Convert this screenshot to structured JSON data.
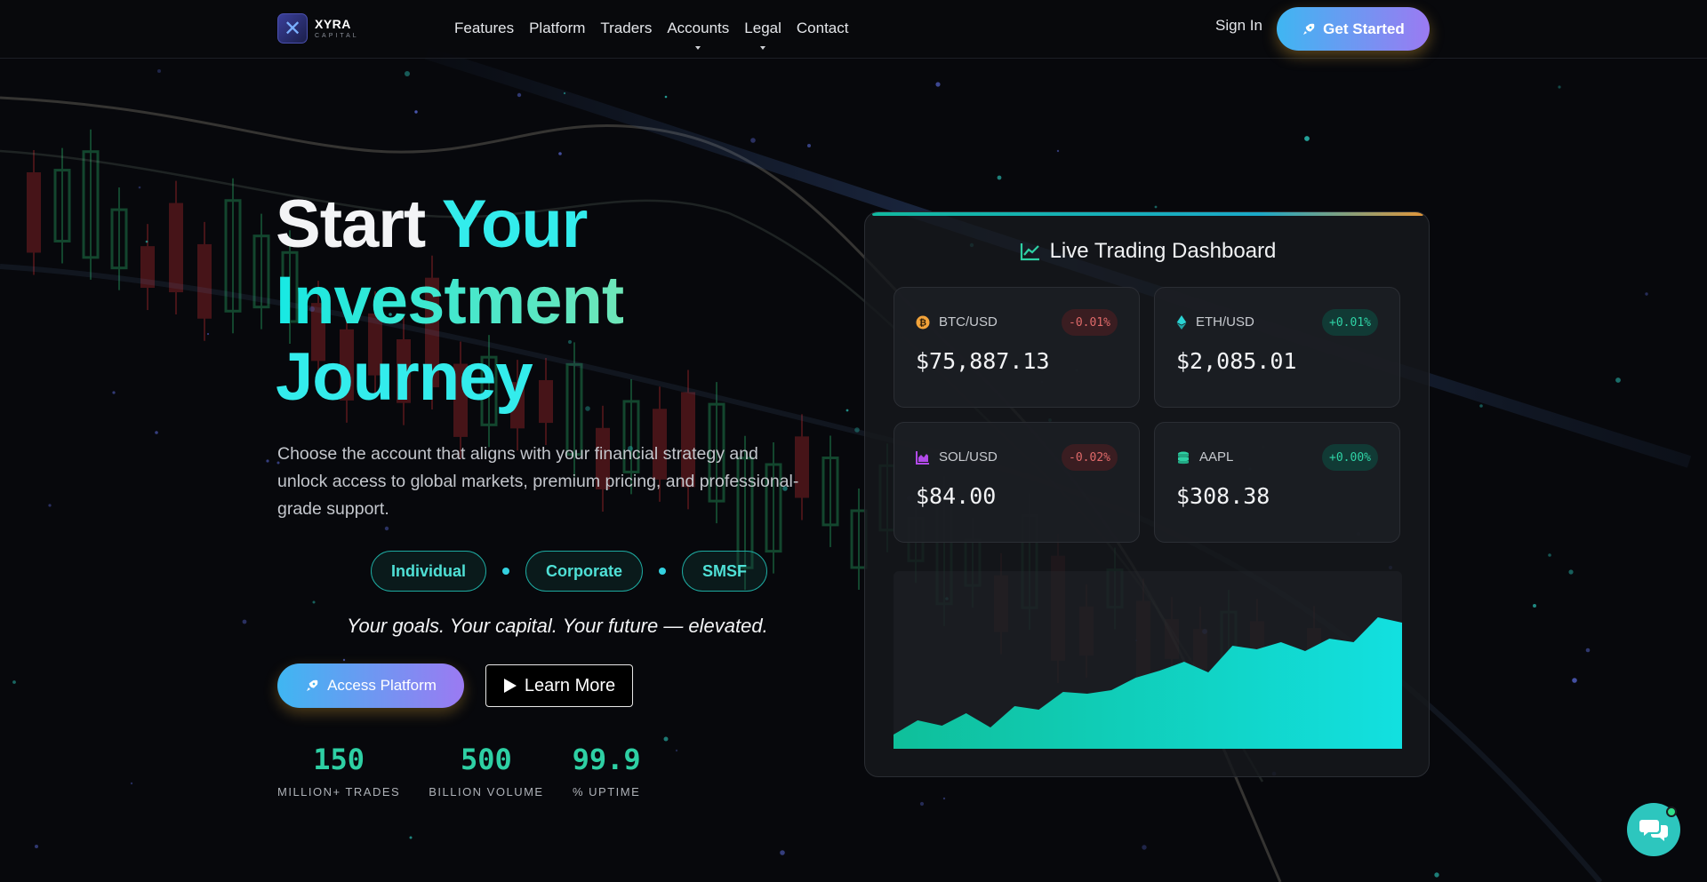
{
  "nav": {
    "logo_name": "XYRA",
    "logo_sub": "CAPITAL",
    "items": [
      {
        "label": "Features"
      },
      {
        "label": "Platform"
      },
      {
        "label": "Traders"
      },
      {
        "label": "Accounts",
        "has_dropdown": true
      },
      {
        "label": "Legal",
        "has_dropdown": true
      },
      {
        "label": "Contact"
      }
    ],
    "sign_in": "Sign In",
    "cta": "Get Started",
    "cta_icon": "rocket-icon"
  },
  "hero": {
    "title_line1_a": "Start",
    "title_line1_b": "Your",
    "title_line2": "Investment",
    "title_line3": "Journey",
    "description": "Choose the account that aligns with your financial strategy and unlock access to global markets, premium pricing, and professional-grade support.",
    "account_types": [
      "Individual",
      "Corporate",
      "SMSF"
    ],
    "tagline": "Your goals. Your capital. Your future — elevated.",
    "primary_button": "Access Platform",
    "secondary_button": "Learn More",
    "stats": [
      {
        "value": "150",
        "label": "MILLION+ TRADES"
      },
      {
        "value": "500",
        "label": "BILLION VOLUME"
      },
      {
        "value": "99.9",
        "label": "% UPTIME"
      }
    ]
  },
  "dashboard": {
    "title": "Live Trading Dashboard",
    "title_icon": "chart-line-icon",
    "tickers": [
      {
        "symbol": "BTC/USD",
        "icon": "bitcoin-icon",
        "icon_color": "#f2a33a",
        "change": "-0.01%",
        "direction": "down",
        "price": "$75,887.13"
      },
      {
        "symbol": "ETH/USD",
        "icon": "ethereum-icon",
        "icon_color": "#2ad4d4",
        "change": "+0.01%",
        "direction": "up",
        "price": "$2,085.01"
      },
      {
        "symbol": "SOL/USD",
        "icon": "bar-chart-icon",
        "icon_color": "#b14ae8",
        "change": "-0.02%",
        "direction": "down",
        "price": "$84.00"
      },
      {
        "symbol": "AAPL",
        "icon": "coins-icon",
        "icon_color": "#2ed0a4",
        "change": "+0.00%",
        "direction": "up",
        "price": "$308.38"
      }
    ],
    "area_chart": {
      "values": [
        0.08,
        0.16,
        0.13,
        0.2,
        0.12,
        0.24,
        0.22,
        0.32,
        0.31,
        0.33,
        0.4,
        0.44,
        0.49,
        0.43,
        0.58,
        0.56,
        0.6,
        0.55,
        0.62,
        0.6,
        0.74,
        0.71
      ]
    }
  },
  "colors": {
    "accent_teal": "#2ed0a4",
    "accent_cyan": "#33ecec",
    "gradient_start": "#3fb6f2",
    "gradient_end": "#9b7af2",
    "negative": "#e06a6a",
    "background": "#07080c"
  },
  "chat": {
    "icon": "chat-bubbles-icon"
  }
}
